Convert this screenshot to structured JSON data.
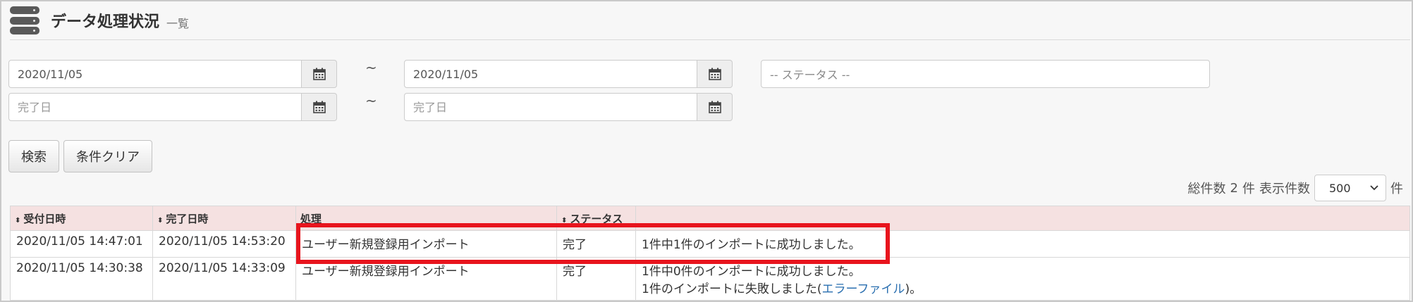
{
  "header": {
    "icon": "database-icon",
    "title": "データ処理状況",
    "subtitle": "一覧"
  },
  "filters": {
    "accepted_from": {
      "value": "2020/11/05",
      "placeholder": ""
    },
    "accepted_to": {
      "value": "2020/11/05",
      "placeholder": ""
    },
    "completed_from": {
      "value": "",
      "placeholder": "完了日"
    },
    "completed_to": {
      "value": "",
      "placeholder": "完了日"
    },
    "range_separator": "~",
    "status_placeholder": "-- ステータス --",
    "calendar_icon": "calendar-icon"
  },
  "buttons": {
    "search": "検索",
    "clear": "条件クリア"
  },
  "count": {
    "total_prefix": "総件数",
    "total_value": "2",
    "total_suffix": "件",
    "per_page_label": "表示件数",
    "per_page_value": "500",
    "per_page_suffix": "件"
  },
  "table": {
    "headers": [
      "受付日時",
      "完了日時",
      "処理",
      "ステータス",
      ""
    ],
    "rows": [
      {
        "accepted": "2020/11/05 14:47:01",
        "completed": "2020/11/05 14:53:20",
        "process": "ユーザー新規登録用インポート",
        "status": "完了",
        "message_line1": "1件中1件のインポートに成功しました。"
      },
      {
        "accepted": "2020/11/05 14:30:38",
        "completed": "2020/11/05 14:33:09",
        "process": "ユーザー新規登録用インポート",
        "status": "完了",
        "message_line1": "1件中0件のインポートに成功しました。",
        "message_line2_prefix": "1件のインポートに失敗しました(",
        "message_line2_link": "エラーファイル",
        "message_line2_suffix": ")。"
      }
    ]
  },
  "colors": {
    "table_header_bg": "#f5e1e1",
    "highlight_border": "#e8141d",
    "link": "#2a6fb0"
  }
}
